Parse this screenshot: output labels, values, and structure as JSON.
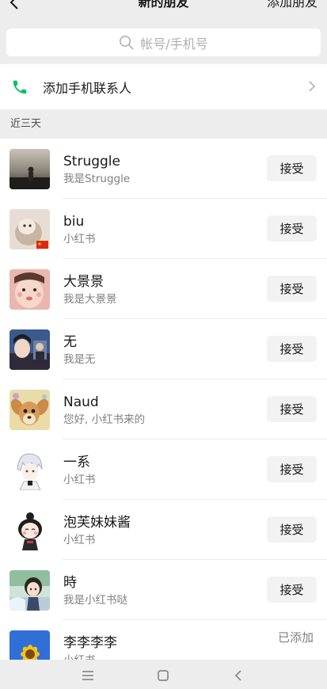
{
  "header": {
    "title": "新的朋友",
    "action": "添加朋友",
    "back_icon": "chevron-left-icon"
  },
  "search": {
    "placeholder": "帐号/手机号",
    "icon": "search-icon"
  },
  "phone_contacts": {
    "label": "添加手机联系人",
    "icon": "phone-icon",
    "accent": "#07c160"
  },
  "section": {
    "label": "近三天"
  },
  "requests": [
    {
      "name": "Struggle",
      "message": "我是Struggle",
      "action": "接受"
    },
    {
      "name": "biu",
      "message": "小红书",
      "action": "接受"
    },
    {
      "name": "大景景",
      "message": "我是大景景",
      "action": "接受"
    },
    {
      "name": "无",
      "message": "我是无",
      "action": "接受"
    },
    {
      "name": "Naud",
      "message": "您好, 小红书来的",
      "action": "接受"
    },
    {
      "name": "一系",
      "message": "小红书",
      "action": "接受"
    },
    {
      "name": "泡芙妹妹酱",
      "message": "小红书",
      "action": "接受"
    },
    {
      "name": "時",
      "message": "我是小红书哒",
      "action": "接受"
    },
    {
      "name": "李李李李",
      "message": "小红书",
      "status": "已添加"
    }
  ],
  "navbar": {
    "icons": [
      "menu-icon",
      "home-icon",
      "back-icon"
    ]
  }
}
